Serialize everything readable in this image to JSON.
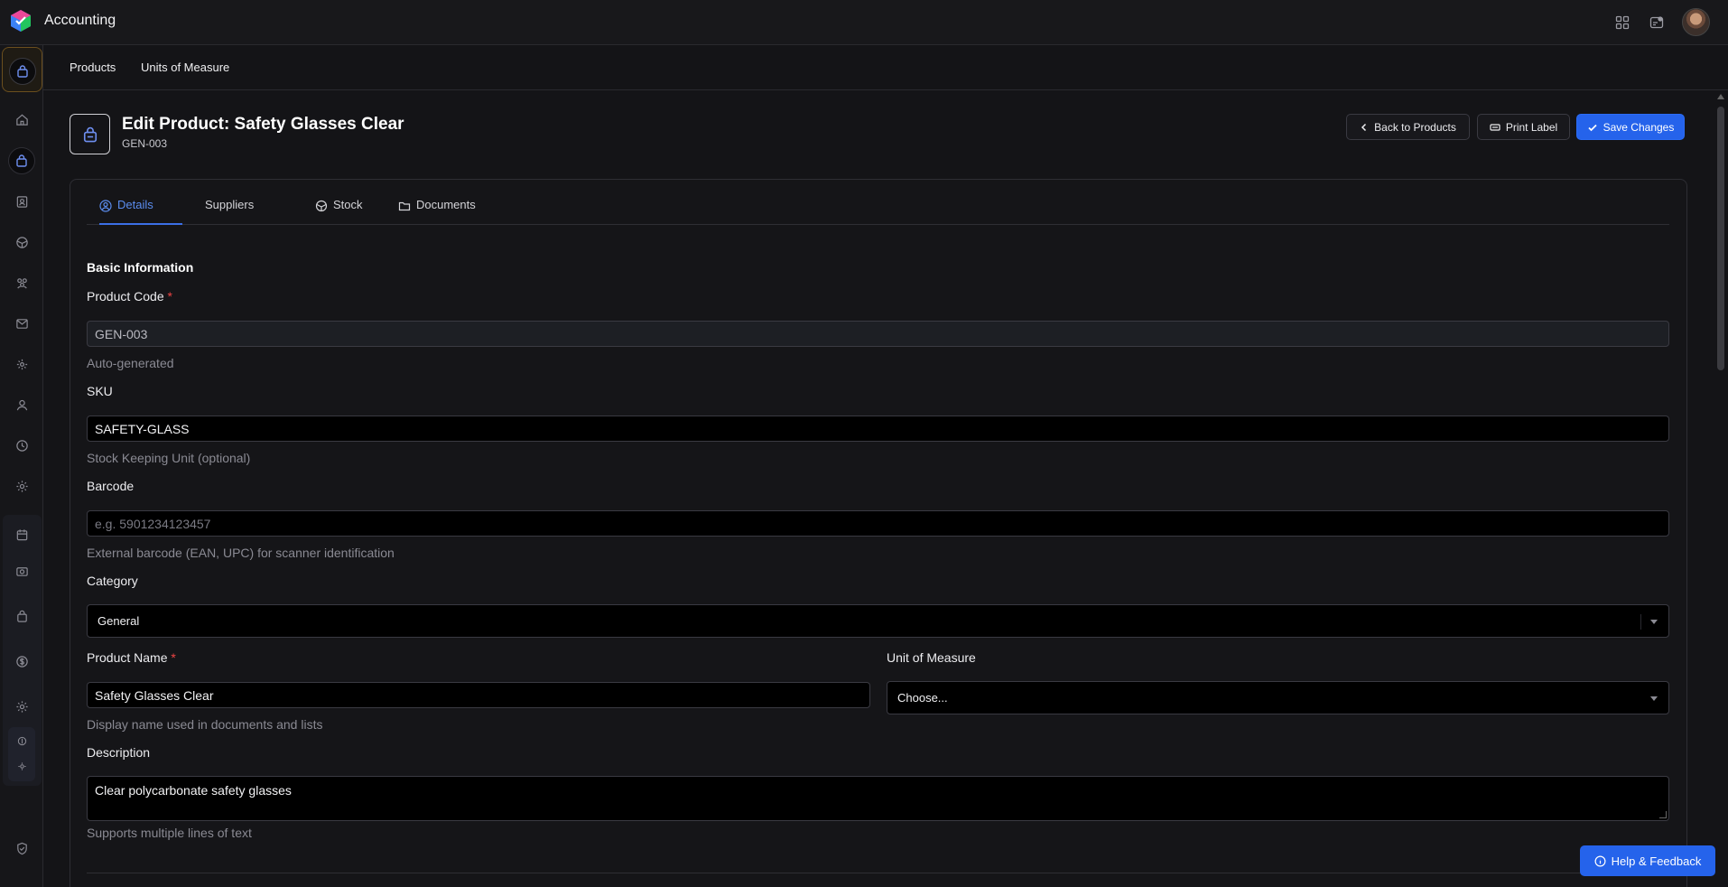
{
  "app": {
    "title": "Accounting"
  },
  "subnav": {
    "items": [
      "Products",
      "Units of Measure"
    ]
  },
  "page": {
    "title": "Edit Product: Safety Glasses Clear",
    "subtitle": "GEN-003",
    "actions": {
      "back": "Back to Products",
      "print": "Print Label",
      "save": "Save Changes"
    }
  },
  "tabs": [
    {
      "label": "Details",
      "icon": "user-circle-icon",
      "active": true
    },
    {
      "label": "Suppliers",
      "icon": "",
      "active": false
    },
    {
      "label": "Stock",
      "icon": "package-icon",
      "active": false
    },
    {
      "label": "Documents",
      "icon": "folder-icon",
      "active": false
    }
  ],
  "form": {
    "section_title": "Basic Information",
    "product_code": {
      "label": "Product Code",
      "required_mark": "*",
      "value": "GEN-003",
      "hint": "Auto-generated"
    },
    "sku": {
      "label": "SKU",
      "value": "SAFETY-GLASS",
      "hint": "Stock Keeping Unit (optional)"
    },
    "barcode": {
      "label": "Barcode",
      "placeholder": "e.g. 5901234123457",
      "hint": "External barcode (EAN, UPC) for scanner identification"
    },
    "category": {
      "label": "Category",
      "value": "General"
    },
    "product_name": {
      "label": "Product Name",
      "required_mark": "*",
      "value": "Safety Glasses Clear",
      "hint": "Display name used in documents and lists"
    },
    "unit_of_measure": {
      "label": "Unit of Measure",
      "value": "Choose..."
    },
    "description": {
      "label": "Description",
      "value": "Clear polycarbonate safety glasses",
      "hint": "Supports multiple lines of text"
    }
  },
  "help": {
    "label": "Help & Feedback"
  },
  "colors": {
    "accent": "#2563eb",
    "required": "#ef4444",
    "background": "#131316"
  }
}
